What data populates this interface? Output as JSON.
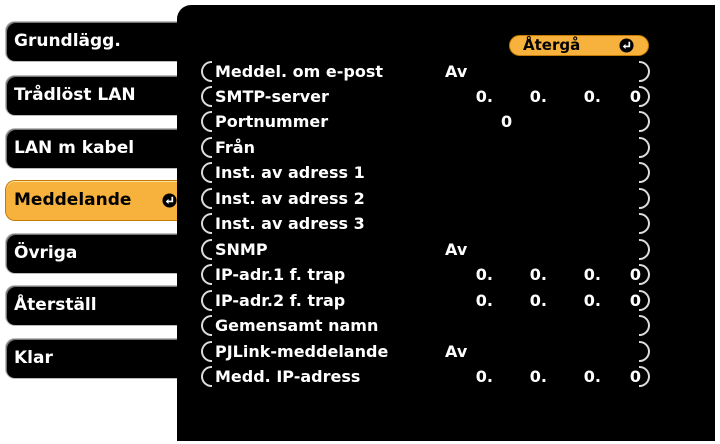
{
  "sidebar": {
    "items": [
      {
        "label": "Grundlägg.",
        "active": false
      },
      {
        "label": "Trådlöst LAN",
        "active": false
      },
      {
        "label": "LAN m kabel",
        "active": false
      },
      {
        "label": "Meddelande",
        "active": true
      },
      {
        "label": "Övriga",
        "active": false
      },
      {
        "label": "Återställ",
        "active": false
      },
      {
        "label": "Klar",
        "active": false
      }
    ]
  },
  "panel": {
    "return_label": "Återgå",
    "rows": [
      {
        "label": "Meddel. om e-post",
        "value": "Av"
      },
      {
        "label": "SMTP-server",
        "ip": [
          "0.",
          "0.",
          "0.",
          "0"
        ]
      },
      {
        "label": "Portnummer",
        "port": "0"
      },
      {
        "label": "Från"
      },
      {
        "label": "Inst. av adress 1"
      },
      {
        "label": "Inst. av adress 2"
      },
      {
        "label": "Inst. av adress 3"
      },
      {
        "label": "SNMP",
        "value": "Av"
      },
      {
        "label": "IP-adr.1 f. trap",
        "ip": [
          "0.",
          "0.",
          "0.",
          "0"
        ]
      },
      {
        "label": "IP-adr.2 f. trap",
        "ip": [
          "0.",
          "0.",
          "0.",
          "0"
        ]
      },
      {
        "label": "Gemensamt namn"
      },
      {
        "label": "PJLink-meddelande",
        "value": "Av"
      },
      {
        "label": "Medd. IP-adress",
        "ip": [
          "0.",
          "0.",
          "0.",
          "0"
        ]
      }
    ]
  },
  "colors": {
    "accent": "#f7b23d",
    "background": "#000000"
  },
  "icons": {
    "enter": "enter-arrow-icon"
  }
}
